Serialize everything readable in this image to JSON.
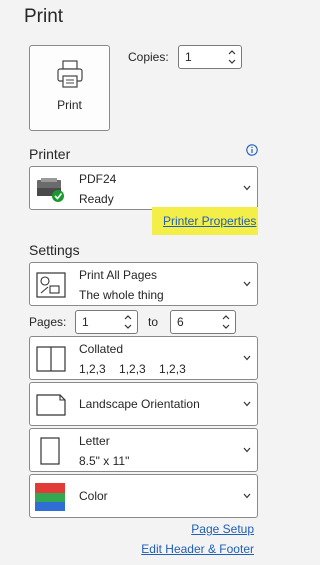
{
  "header": {
    "title": "Print"
  },
  "print_button": {
    "label": "Print",
    "icon": "printer-icon"
  },
  "copies": {
    "label": "Copies:",
    "value": "1"
  },
  "printer": {
    "section_label": "Printer",
    "name": "PDF24",
    "status": "Ready",
    "properties_link": "Printer Properties"
  },
  "settings": {
    "section_label": "Settings",
    "print_range": {
      "title": "Print All Pages",
      "subtitle": "The whole thing"
    },
    "pages": {
      "label": "Pages:",
      "from": "1",
      "to_label": "to",
      "to": "6"
    },
    "collation": {
      "title": "Collated",
      "subtitle": "1,2,3    1,2,3    1,2,3"
    },
    "orientation": {
      "title": "Landscape Orientation"
    },
    "paper": {
      "title": "Letter",
      "subtitle": "8.5\" x 11\""
    },
    "color": {
      "title": "Color"
    }
  },
  "footer": {
    "page_setup": "Page Setup",
    "edit_header_footer": "Edit Header & Footer"
  },
  "colors": {
    "accent_link": "#1f5fb5",
    "highlight": "#f4ef48",
    "status_green": "#1a9a2e"
  }
}
